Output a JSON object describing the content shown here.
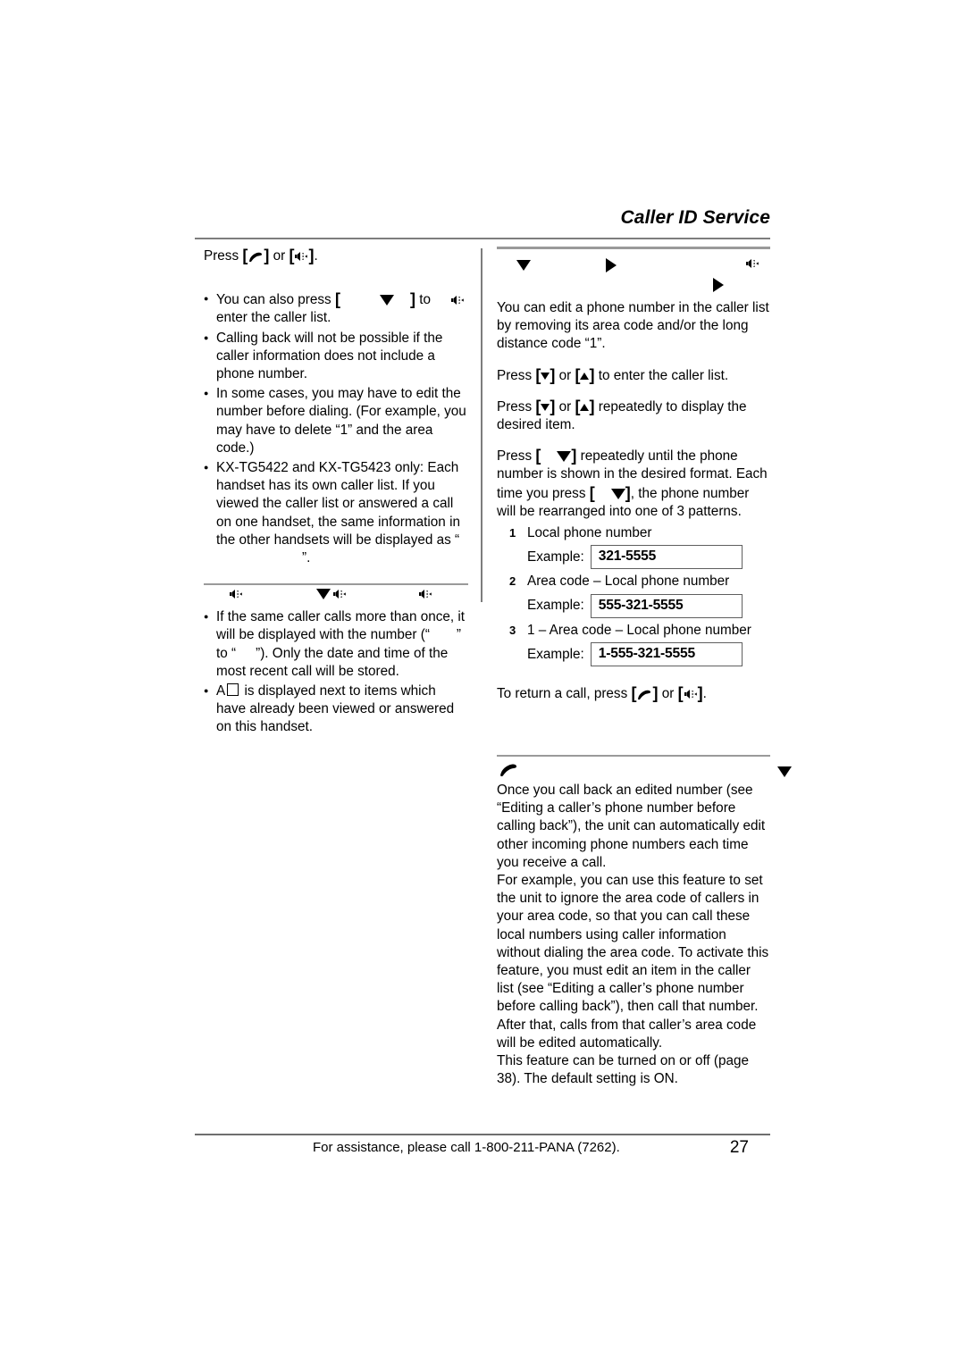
{
  "header": {
    "title": "Caller ID Service"
  },
  "left_column": {
    "press_line": {
      "prefix": "Press",
      "or": "or",
      "suffix": ".",
      "keys": [
        "handset-icon",
        "speaker-icon"
      ]
    },
    "bullets": [
      {
        "id": "also-press",
        "text_before": "You can also press",
        "text_after": "to enter the caller list.",
        "trailing_icon": "speaker-icon"
      },
      {
        "id": "calling-back",
        "text": "Calling back will not be possible if the caller information does not include a phone number."
      },
      {
        "id": "edit-number",
        "text": "In some cases, you may have to edit the number before dialing. (For example, you may have to delete “1” and the area code.)"
      },
      {
        "id": "own-caller-list",
        "text": "KX-TG5422 and KX-TG5423 only: Each handset has its own caller list. If you viewed the caller list or answered a call on one handset, the same information in the other handsets will be displayed as “",
        "text_end": "”."
      }
    ],
    "second_section": {
      "icons": [
        "speaker-icon",
        "down-triangle-icon",
        "speaker-icon",
        "speaker-icon"
      ],
      "bullets": [
        {
          "id": "same-caller",
          "part1": "If the same caller calls more than once, it will be displayed with the number (“",
          "part2": "” to “",
          "part3": "”). Only the date and time of the most recent call will be stored."
        },
        {
          "id": "viewed-marker",
          "part1": "A",
          "part2": "is displayed next to items which have already been viewed or answered on this handset."
        }
      ]
    }
  },
  "right_column": {
    "section_icons": [
      "down-triangle-icon",
      "right-triangle-icon",
      "speaker-icon",
      "right-triangle-icon"
    ],
    "intro": "You can edit a phone number in the caller list by removing its area code and/or the long distance code “1”.",
    "steps": [
      {
        "id": "enter-caller-list",
        "prefix": "Press",
        "middle": "or",
        "suffix": "to enter the caller list.",
        "keys": [
          "down-triangle",
          "up-triangle"
        ]
      },
      {
        "id": "display-item",
        "prefix": "Press",
        "middle": "or",
        "suffix": "repeatedly to display the desired item.",
        "keys": [
          "down-triangle",
          "up-triangle"
        ]
      },
      {
        "id": "format-number",
        "prefix": "Press",
        "part2": "repeatedly until the phone number is shown in the desired format. Each time you press",
        "part3": ", the phone number will be rearranged into one of 3 patterns."
      }
    ],
    "patterns": [
      {
        "num": "1",
        "label": "Local phone number",
        "example_label": "Example:",
        "example_value": "321-5555"
      },
      {
        "num": "2",
        "label": "Area code – Local phone number",
        "example_label": "Example:",
        "example_value": "555-321-5555"
      },
      {
        "num": "3",
        "label": "1 – Area code – Local phone number",
        "example_label": "Example:",
        "example_value": "1-555-321-5555"
      }
    ],
    "return_call": {
      "prefix": "To return a call, press",
      "or": "or",
      "suffix": "."
    }
  },
  "bottom_block": {
    "icon": "handset-icon",
    "outer_marker": "down-triangle-icon",
    "paragraphs": [
      "Once you call back an edited number (see “Editing a caller’s phone number before calling back”), the unit can automatically edit other incoming phone numbers each time you receive a call.",
      "For example, you can use this feature to set the unit to ignore the area code of callers in your area code, so that you can call these local numbers using caller information without dialing the area code. To activate this feature, you must edit an item in the caller list (see “Editing a caller’s phone number before calling back”), then call that number. After that, calls from that caller’s area code will be edited automatically.",
      "This feature can be turned on or off (page 38). The default setting is ON."
    ]
  },
  "footer": {
    "assistance": "For assistance, please call 1-800-211-PANA (7262).",
    "page_number": "27"
  }
}
